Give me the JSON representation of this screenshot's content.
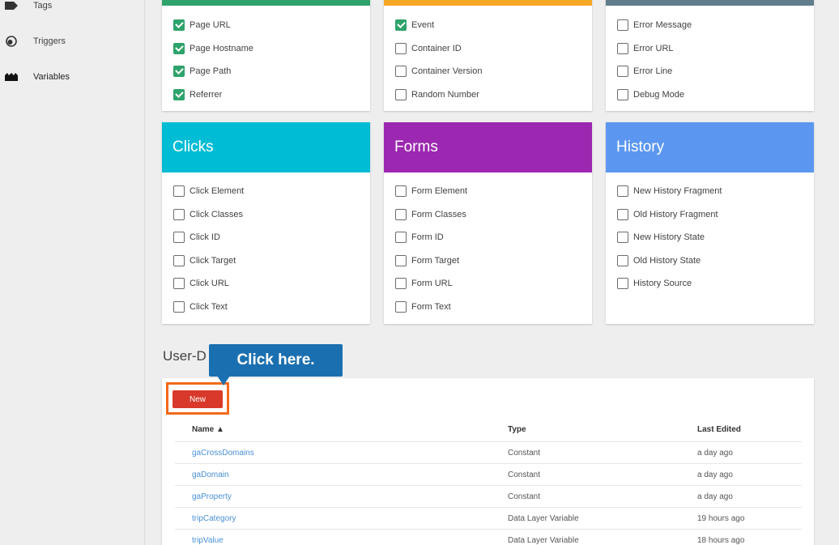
{
  "sidebar": {
    "items": [
      {
        "label": "Tags",
        "icon": "tag-icon"
      },
      {
        "label": "Triggers",
        "icon": "trigger-icon"
      },
      {
        "label": "Variables",
        "icon": "variables-icon"
      }
    ]
  },
  "cards": {
    "pages": {
      "accent": "#2ea36b",
      "items": [
        {
          "label": "Page URL",
          "checked": true
        },
        {
          "label": "Page Hostname",
          "checked": true
        },
        {
          "label": "Page Path",
          "checked": true
        },
        {
          "label": "Referrer",
          "checked": true
        }
      ]
    },
    "utilities": {
      "accent": "#f9a825",
      "items": [
        {
          "label": "Event",
          "checked": true
        },
        {
          "label": "Container ID",
          "checked": false
        },
        {
          "label": "Container Version",
          "checked": false
        },
        {
          "label": "Random Number",
          "checked": false
        }
      ]
    },
    "errors": {
      "accent": "#607d8b",
      "items": [
        {
          "label": "Error Message",
          "checked": false
        },
        {
          "label": "Error URL",
          "checked": false
        },
        {
          "label": "Error Line",
          "checked": false
        },
        {
          "label": "Debug Mode",
          "checked": false
        }
      ]
    },
    "clicks": {
      "title": "Clicks",
      "color": "#00bcd4",
      "items": [
        {
          "label": "Click Element",
          "checked": false
        },
        {
          "label": "Click Classes",
          "checked": false
        },
        {
          "label": "Click ID",
          "checked": false
        },
        {
          "label": "Click Target",
          "checked": false
        },
        {
          "label": "Click URL",
          "checked": false
        },
        {
          "label": "Click Text",
          "checked": false
        }
      ]
    },
    "forms": {
      "title": "Forms",
      "color": "#9c27b0",
      "items": [
        {
          "label": "Form Element",
          "checked": false
        },
        {
          "label": "Form Classes",
          "checked": false
        },
        {
          "label": "Form ID",
          "checked": false
        },
        {
          "label": "Form Target",
          "checked": false
        },
        {
          "label": "Form URL",
          "checked": false
        },
        {
          "label": "Form Text",
          "checked": false
        }
      ]
    },
    "history": {
      "title": "History",
      "color": "#5b97f0",
      "items": [
        {
          "label": "New History Fragment",
          "checked": false
        },
        {
          "label": "Old History Fragment",
          "checked": false
        },
        {
          "label": "New History State",
          "checked": false
        },
        {
          "label": "Old History State",
          "checked": false
        },
        {
          "label": "History Source",
          "checked": false
        }
      ]
    }
  },
  "user_defined": {
    "title_visible": "User-D",
    "new_button": "New",
    "columns": {
      "name": "Name ▲",
      "type": "Type",
      "last_edited": "Last Edited"
    },
    "rows": [
      {
        "name": "gaCrossDomains",
        "type": "Constant",
        "edited": "a day ago"
      },
      {
        "name": "gaDomain",
        "type": "Constant",
        "edited": "a day ago"
      },
      {
        "name": "gaProperty",
        "type": "Constant",
        "edited": "a day ago"
      },
      {
        "name": "tripCategory",
        "type": "Data Layer Variable",
        "edited": "19 hours ago"
      },
      {
        "name": "tripValue",
        "type": "Data Layer Variable",
        "edited": "18 hours ago"
      }
    ]
  },
  "callout": {
    "text": "Click here.",
    "color": "#1a6fb0",
    "highlight_color": "#f36a1c"
  }
}
